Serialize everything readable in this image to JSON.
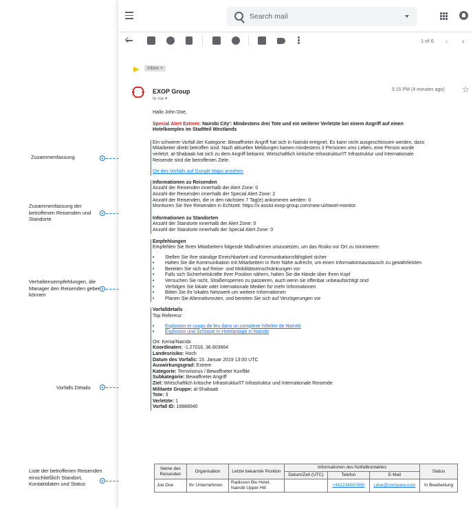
{
  "annotations": [
    {
      "id": "summary",
      "label": "Zusammenfassung"
    },
    {
      "id": "travelers",
      "label": "Zusammenfassung der betroffenen Reisenden und Standorte"
    },
    {
      "id": "recommendations",
      "label": "Verhaltensempfehlungen, die Manager den Reisenden geben können"
    },
    {
      "id": "details",
      "label": "Vorfalls Details"
    },
    {
      "id": "list",
      "label": "Liste der betroffenen Reisenden einschließlich Standort, Kontaktdaten und Status"
    }
  ],
  "header": {
    "search_placeholder": "Search mail"
  },
  "toolbar": {
    "pager": "1 of 6"
  },
  "message": {
    "label_chip": "Inbox ×",
    "sender": "EXOP Group",
    "recipient": "to me ▾",
    "timestamp": "5:15 PM (4 minutes ago)"
  },
  "email": {
    "greeting": "Hallo John Doe,",
    "alert_prefix": "Special Alert Extrem:",
    "alert_title": " Nairobi City': Mindestens drei Tote und ein weiterer Verletzte bei einem Angriff auf einen Hotelkomplex im Stadtteil Westlands",
    "summary_text": "Ein schwerer Vorfall der Kategorie: Bewaffneter Angriff hat sich in Nairobi ereignet. Es kann nicht ausgeschlossen werden, dass Mitarbeiter direkt betroffen sind. Nach aktuellen Meldungen kamen mindestens 3 Personen ums Leben, eine Person wurde verletzt. al-Shabaab hat sich zu dem Angriff bekannt. Wirtschaftlich kritische Infrastruktur/IT Infrastruktur und Internationale Reisende sind die betroffenen Ziele.",
    "map_link": "Ort des Vorfalls auf Google Maps ansehen",
    "travelers_title": "Informationen zu Reisenden",
    "travelers_lines": [
      "Anzahl der Reisenden innerhalb der Alert Zone: 0",
      "Anzahl der Reisenden innerhalb der Special Alert Zone: 2",
      "Anzahl der Reisenden, die in den nächsten 7 Tag(e) ankommen werden: 0",
      "Monitoren Sie Ihre Reisenden in Echtzeit: https://x-assist.exop-group.com/new-ui/travel-monitor."
    ],
    "locations_title": "Informationen zu Standorten",
    "locations_lines": [
      "Anzahl der Standorte innerhalb der Alert Zone: 0",
      "Anzahl der Standorte innerhalb der Special Alert Zone: 0"
    ],
    "recommendations_title": "Empfehlungen",
    "recommendations_intro": "Empfehlen Sie Ihren Mitarbeitern folgende Maßnahmen umzusetzen, um das Risiko vor Ort zu minimieren:",
    "recommendations": [
      "Stellen Sie Ihre ständige Erreichbarkeit und Kommunikationsfähigkeit sicher",
      "Halten Sie die Kommunikation mit Mitarbeitern in Ihrer Nähe aufrecht, um einen Informationsaustausch zu gewährleisten",
      "Bereiten Sie sich auf Reise- und Mobilitätseinschränkungen vor",
      "Falls sich Sicherheitskräfte Ihrer Position nähern, halten Sie die Hände über Ihren Kopf",
      "Versuchen Sie nicht, Straßensperren zu passieren, auch wenn sie offenbar unbeaufsichtigt sind",
      "Verfolgen Sie lokale oder internationale Medien für mehr Informationen",
      "Bitten Sie Ihr lokales Netzwerk um weitere Informationen",
      "Planen Sie Alternativrouten, und bereiten Sie sich auf Verzögerungen vor"
    ],
    "details_title": "Vorfalldetails",
    "top_ref": "Top Referenz:",
    "ref_links": [
      "Explosion et coups de feu dans un complexe hôtelier de Nairobi",
      "Explosion und Schüsse in Hotelanlage in Nairobi"
    ],
    "details": [
      {
        "k": "Ort:",
        "v": " Kenia/Nairobi"
      },
      {
        "k": "Koordinaten:",
        "v": " -1.27016, 36.803664"
      },
      {
        "k": "Landesrisiko:",
        "v": " Hoch"
      },
      {
        "k": "Datum des Vorfalls:",
        "v": " 15. Januar 2019 13:00 UTC"
      },
      {
        "k": "Auswirkungsgrad:",
        "v": " Extrem"
      },
      {
        "k": "Kategorie:",
        "v": " Terrorismus / Bewaffneter Konflikt"
      },
      {
        "k": "Subkategorie:",
        "v": " Bewaffneter Angriff"
      },
      {
        "k": "Ziel:",
        "v": " Wirtschaftlich kritische Infrastruktur/IT Infrastruktur und Internationale Reisende"
      },
      {
        "k": "Militante Gruppe:",
        "v": " al-Shabaab"
      },
      {
        "k": "Tote:",
        "v": " 3"
      },
      {
        "k": "Verletzte:",
        "v": " 1"
      },
      {
        "k": "Vorfall ID:",
        "v": " 16888940"
      }
    ]
  },
  "table": {
    "headers": {
      "name": "Name des Reisenden",
      "org": "Organisation",
      "pos": "Letzte bekannte Position",
      "contact": "Informationen des Notfallkontaktes",
      "status": "Status",
      "dt": "Datum/Zeit (UTC)",
      "phone": "Telefon",
      "email": "E-Mail"
    },
    "row": {
      "name": "Joe Doe",
      "org": "Ihr Unternehmen",
      "pos": "Radisson Blu Hotel, Nairobi Upper Hill",
      "dt": "",
      "phone": "+491234567890",
      "email": "j.doe@company.com",
      "status": "In Bearbeitung"
    }
  },
  "colors": {
    "accent": "#29a3e0",
    "logo": "#c5221f",
    "alert": "#c5221f",
    "link": "#1a73e8"
  }
}
